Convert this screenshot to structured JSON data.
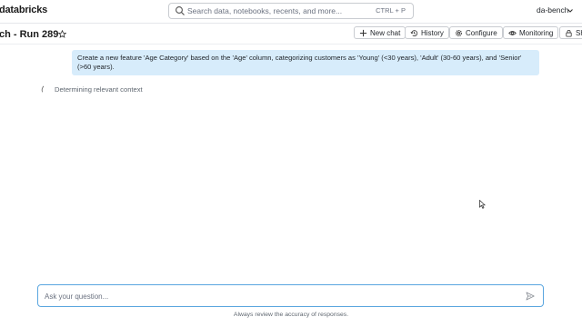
{
  "header": {
    "brand": "databricks",
    "search_placeholder": "Search data, notebooks, recents, and more...",
    "search_shortcut": "CTRL + P",
    "user": "da-bench"
  },
  "titlebar": {
    "title": "ch - Run 289",
    "buttons": {
      "new_chat": "New chat",
      "history": "History",
      "configure": "Configure",
      "monitoring": "Monitoring",
      "share": "Sh"
    }
  },
  "chat": {
    "user_message": "Create a new feature 'Age Category' based on the 'Age' column, categorizing customers as 'Young' (<30 years), 'Adult' (30-60 years), and 'Senior' (>60 years).",
    "status": "Determining relevant context"
  },
  "composer": {
    "placeholder": "Ask your question...",
    "disclaimer": "Always review the accuracy of responses."
  },
  "icons": {
    "search": "search-icon",
    "chevron": "chevron-down-icon",
    "star": "star-icon",
    "plus": "plus-icon",
    "history": "history-icon",
    "configure": "gear-icon",
    "monitoring": "eye-icon",
    "share": "lock-icon",
    "send": "send-icon"
  },
  "colors": {
    "bubble": "#d7ecfb",
    "composer_border": "#5aa6df"
  }
}
